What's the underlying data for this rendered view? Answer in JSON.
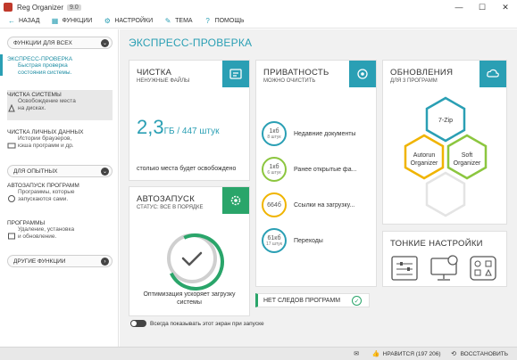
{
  "window": {
    "title": "Reg Organizer",
    "version": "9.0",
    "min_label": "—",
    "max_label": "☐",
    "close_label": "✕"
  },
  "menu": [
    {
      "icon": "back-arrow-icon",
      "label": "Назад"
    },
    {
      "icon": "functions-icon",
      "label": "Функции"
    },
    {
      "icon": "settings-icon",
      "label": "Настройки"
    },
    {
      "icon": "theme-icon",
      "label": "Тема"
    },
    {
      "icon": "help-icon",
      "label": "Помощь"
    }
  ],
  "sidebar": {
    "section_all": "ФУНКЦИИ ДЛЯ ВСЕХ",
    "section_pro": "ДЛЯ ОПЫТНЫХ",
    "section_other": "ДРУГИЕ ФУНКЦИИ",
    "items": [
      {
        "title": "ЭКСПРЕСС-ПРОВЕРКА",
        "desc1": "Быстрая проверка",
        "desc2": "состояния системы."
      },
      {
        "title": "ЧИСТКА СИСТЕМЫ",
        "desc1": "Освобождение места",
        "desc2": "на дисках."
      },
      {
        "title": "ЧИСТКА ЛИЧНЫХ ДАННЫХ",
        "desc1": "Истории браузеров,",
        "desc2": "кэша программ и др."
      },
      {
        "title": "АВТОЗАПУСК ПРОГРАММ",
        "desc1": "Программы, которые",
        "desc2": "запускаются сами."
      },
      {
        "title": "ПРОГРАММЫ",
        "desc1": "Удаление, установка",
        "desc2": "и обновление."
      }
    ]
  },
  "main": {
    "title": "ЭКСПРЕСС-ПРОВЕРКА",
    "clean": {
      "title": "ЧИСТКА",
      "subtitle": "НЕНУЖНЫЕ ФАЙЛЫ",
      "value": "2,3",
      "unit": "ГБ / 447 штук",
      "note": "столько места будет освобождено"
    },
    "privacy": {
      "title": "ПРИВАТНОСТЬ",
      "subtitle": "МОЖНО ОЧИСТИТЬ",
      "rows": [
        {
          "value": "1кб",
          "count": "8 штук",
          "label": "Недавние документы",
          "color": "#2a9fb4"
        },
        {
          "value": "1кб",
          "count": "6 штук",
          "label": "Ранее открытые фа...",
          "color": "#8cc63f"
        },
        {
          "value": "664б",
          "count": "",
          "label": "Ссылки на загрузку...",
          "color": "#f0b400"
        },
        {
          "value": "61кб",
          "count": "17 штук",
          "label": "Переходы",
          "color": "#2a9fb4"
        }
      ]
    },
    "updates": {
      "title": "ОБНОВЛЕНИЯ",
      "subtitle": "ДЛЯ 3 ПРОГРАММ",
      "apps": [
        {
          "name": "7-Zip",
          "color": "#2a9fb4"
        },
        {
          "name": "Autorun Organizer",
          "line1": "Autorun",
          "line2": "Organizer",
          "color": "#f0b400"
        },
        {
          "name": "Soft Organizer",
          "line1": "Soft",
          "line2": "Organizer",
          "color": "#8cc63f"
        }
      ]
    },
    "autorun": {
      "title": "АВТОЗАПУСК",
      "subtitle": "СТАТУС: ВСЕ В ПОРЯДКЕ",
      "note1": "Оптимизация ускоряет загрузку",
      "note2": "системы"
    },
    "tuning": {
      "title": "ТОНКИЕ НАСТРОЙКИ"
    },
    "noapps": "НЕТ СЛЕДОВ ПРОГРАММ",
    "show_toggle": "Всегда показывать этот экран при запуске"
  },
  "status": {
    "like": "НРАВИТСЯ (197 206)",
    "restore": "ВОССТАНОВИТЬ"
  },
  "colors": {
    "accent": "#2a9fb4",
    "green": "#2aa56a",
    "yellow": "#f0b400",
    "lime": "#8cc63f"
  }
}
